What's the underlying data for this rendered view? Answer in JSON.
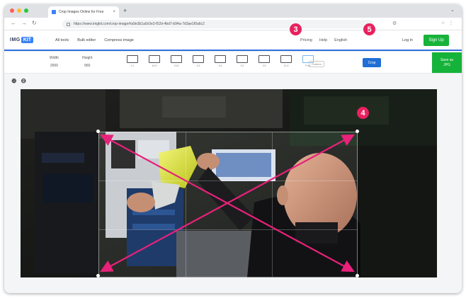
{
  "browser": {
    "tab_title": "Crop Images Online for Free",
    "tab_close": "×",
    "new_tab": "+",
    "url": "https://www.imgkit.com/crop-image#/a9e3b1a0c0e2-f52d-4bd7-b94a-7d3ae1f0a6c2",
    "back_glyph": "←",
    "forward_glyph": "→",
    "reload_glyph": "↻"
  },
  "site": {
    "logo_left": "IMG",
    "logo_mid": "KIT",
    "logo_right": "",
    "nav": [
      "All tools",
      "Bulk editor",
      "Compress image"
    ],
    "header_right": [
      "Pricing",
      "Help",
      "English"
    ],
    "login": "Log in",
    "signup": "Sign Up"
  },
  "toolbar": {
    "width_label": "Width",
    "width_value": "2000",
    "height_label": "Height",
    "height_value": "960",
    "presets": [
      {
        "label": "1:1"
      },
      {
        "label": "16:9"
      },
      {
        "label": "9:16"
      },
      {
        "label": "4:3"
      },
      {
        "label": "3:4"
      },
      {
        "label": "3:2"
      },
      {
        "label": "2:3"
      },
      {
        "label": "21:9"
      },
      {
        "label": "Free",
        "active": true
      }
    ],
    "preset_more": "Custom",
    "crop_label": "Crop",
    "save_label": "Save as\nJPG"
  },
  "zoom": {
    "in": "⊕",
    "out": "⊖"
  },
  "badges": {
    "three": "3",
    "four": "4",
    "five": "5"
  },
  "colors": {
    "accent_blue": "#2d6fdc",
    "brand_green": "#16b33a",
    "badge_pink": "#e8215f",
    "arrow_pink": "#e8217a"
  }
}
